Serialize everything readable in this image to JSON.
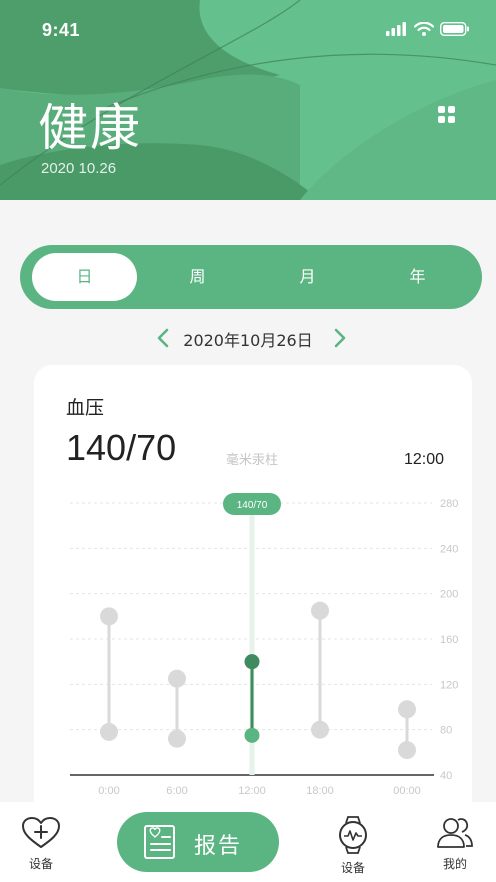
{
  "status_bar": {
    "time": "9:41"
  },
  "header": {
    "title": "健康",
    "date": "2020 10.26",
    "menu_icon": "grid-icon"
  },
  "period_tabs": [
    {
      "label": "日",
      "active": true
    },
    {
      "label": "周",
      "active": false
    },
    {
      "label": "月",
      "active": false
    },
    {
      "label": "年",
      "active": false
    }
  ],
  "date_nav": {
    "date": "2020年10月26日"
  },
  "card": {
    "title": "血压",
    "value": "140/70",
    "unit": "毫米汞柱",
    "time": "12:00"
  },
  "chart_data": {
    "type": "range",
    "categories": [
      "0:00",
      "6:00",
      "12:00",
      "18:00",
      "00:00"
    ],
    "series": [
      {
        "values": [
          [
            78,
            180
          ],
          [
            72,
            125
          ],
          [
            75,
            140
          ],
          [
            80,
            185
          ],
          [
            62,
            98
          ]
        ]
      }
    ],
    "highlight": {
      "index": 2,
      "label": "140/70"
    },
    "y_ticks": [
      40,
      80,
      120,
      160,
      200,
      240,
      280
    ],
    "ylim": [
      40,
      280
    ],
    "grid": true,
    "colors": {
      "default": "#d9d9d9",
      "highlight": "#5bb583",
      "highlight_dark": "#3f8a5e"
    }
  },
  "tab_bar": {
    "tabs": [
      {
        "label": "设备",
        "icon": "heart-plus-icon"
      },
      {
        "label": "设备",
        "icon": "watch-icon"
      },
      {
        "label": "我的",
        "icon": "users-icon"
      }
    ],
    "report": {
      "label": "报告",
      "icon": "report-icon"
    }
  },
  "colors": {
    "primary": "#5bb583",
    "header": "#64c08c"
  }
}
